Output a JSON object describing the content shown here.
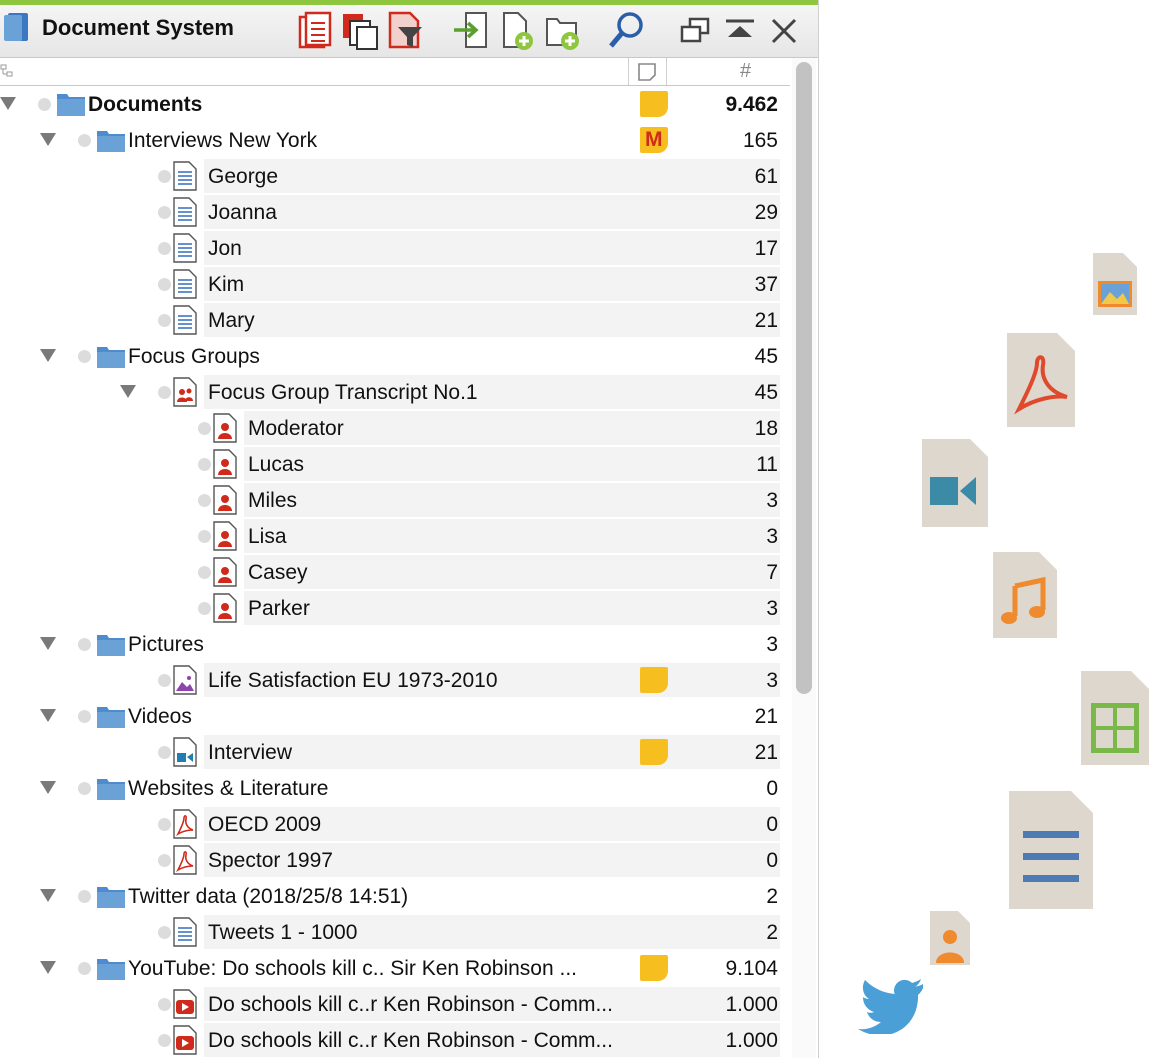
{
  "window": {
    "title": "Document System"
  },
  "icons": {
    "app": "document-system-icon",
    "toolbar": [
      "clipboard-activate-icon",
      "copy-documents-icon",
      "filter-documents-icon",
      "import-icon",
      "new-document-icon",
      "new-folder-icon",
      "search-icon",
      "undock-window-icon",
      "collapse-window-icon",
      "close-icon"
    ],
    "decorative": [
      "image-file-icon",
      "pdf-file-icon",
      "video-file-icon",
      "audio-file-icon",
      "spreadsheet-file-icon",
      "text-file-icon",
      "person-file-icon",
      "twitter-icon"
    ]
  },
  "columns": {
    "memo_header": "memo-column-icon",
    "count_header": "#"
  },
  "colors": {
    "accent": "#8ec63f",
    "memo": "#f6be1e",
    "folder": "#6aa2d8",
    "pdf_red": "#d02a1c",
    "text_blue": "#3e77c1"
  },
  "tree": [
    {
      "label": "Documents",
      "count": "9.462",
      "level": 0,
      "type": "root-folder",
      "memo": true,
      "bold": true
    },
    {
      "label": "Interviews New York",
      "count": "165",
      "level": 1,
      "type": "folder",
      "memo": "M"
    },
    {
      "label": "George",
      "count": "61",
      "level": 2,
      "type": "text"
    },
    {
      "label": "Joanna",
      "count": "29",
      "level": 2,
      "type": "text"
    },
    {
      "label": "Jon",
      "count": "17",
      "level": 2,
      "type": "text"
    },
    {
      "label": "Kim",
      "count": "37",
      "level": 2,
      "type": "text"
    },
    {
      "label": "Mary",
      "count": "21",
      "level": 2,
      "type": "text"
    },
    {
      "label": "Focus Groups",
      "count": "45",
      "level": 1,
      "type": "folder"
    },
    {
      "label": "Focus Group Transcript No.1",
      "count": "45",
      "level": 2,
      "type": "focus-group",
      "expanded": true
    },
    {
      "label": "Moderator",
      "count": "18",
      "level": 3,
      "type": "speaker"
    },
    {
      "label": "Lucas",
      "count": "11",
      "level": 3,
      "type": "speaker"
    },
    {
      "label": "Miles",
      "count": "3",
      "level": 3,
      "type": "speaker"
    },
    {
      "label": "Lisa",
      "count": "3",
      "level": 3,
      "type": "speaker"
    },
    {
      "label": "Casey",
      "count": "7",
      "level": 3,
      "type": "speaker"
    },
    {
      "label": "Parker",
      "count": "3",
      "level": 3,
      "type": "speaker"
    },
    {
      "label": "Pictures",
      "count": "3",
      "level": 1,
      "type": "folder"
    },
    {
      "label": "Life Satisfaction EU 1973-2010",
      "count": "3",
      "level": 2,
      "type": "image",
      "memo": true
    },
    {
      "label": "Videos",
      "count": "21",
      "level": 1,
      "type": "folder"
    },
    {
      "label": "Interview",
      "count": "21",
      "level": 2,
      "type": "video",
      "memo": true
    },
    {
      "label": "Websites & Literature",
      "count": "0",
      "level": 1,
      "type": "folder"
    },
    {
      "label": "OECD 2009",
      "count": "0",
      "level": 2,
      "type": "pdf"
    },
    {
      "label": "Spector 1997",
      "count": "0",
      "level": 2,
      "type": "pdf"
    },
    {
      "label": "Twitter data (2018/25/8 14:51)",
      "count": "2",
      "level": 1,
      "type": "folder"
    },
    {
      "label": "Tweets 1 - 1000",
      "count": "2",
      "level": 2,
      "type": "text"
    },
    {
      "label": "YouTube: Do schools kill c.. Sir Ken Robinson ...",
      "count": "9.104",
      "level": 1,
      "type": "folder",
      "memo": true
    },
    {
      "label": "Do schools kill c..r Ken Robinson -  Comm...",
      "count": "1.000",
      "level": 2,
      "type": "youtube"
    },
    {
      "label": "Do schools kill c..r Ken Robinson -  Comm...",
      "count": "1.000",
      "level": 2,
      "type": "youtube"
    }
  ]
}
